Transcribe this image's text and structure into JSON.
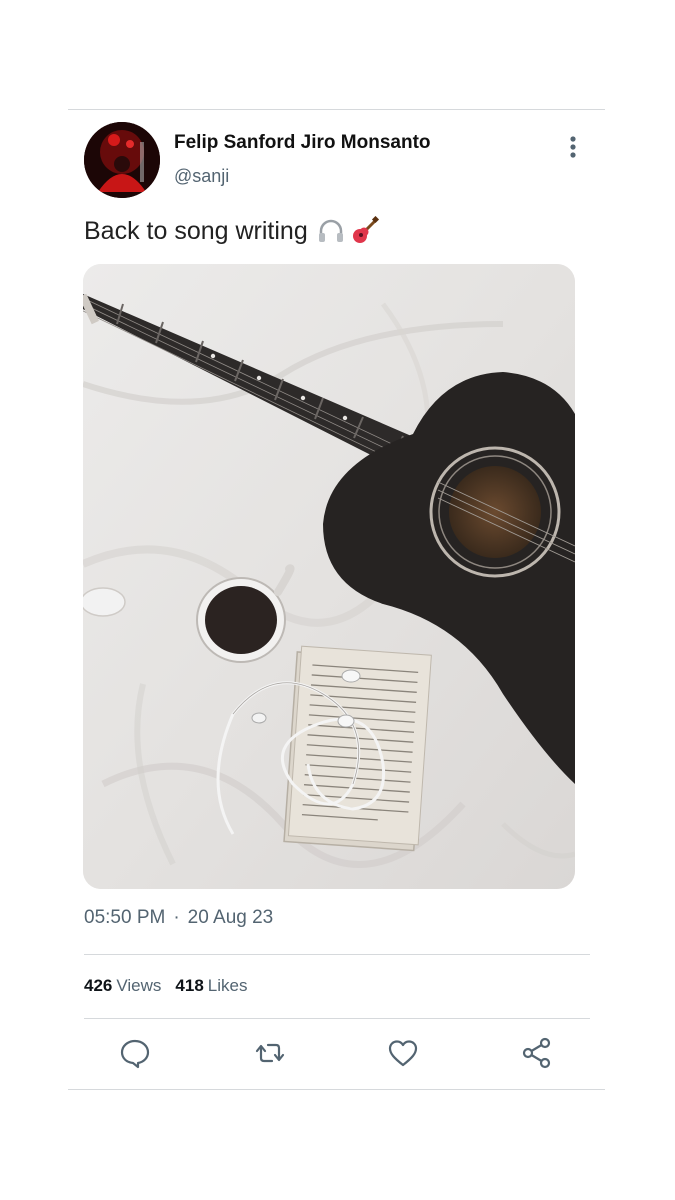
{
  "tweet": {
    "author_name": "Felip Sanford Jiro Monsanto",
    "handle": "@sanji",
    "text": "Back to song writing",
    "emojis": [
      "headphone-icon",
      "guitar-icon"
    ],
    "time": "05:50 PM",
    "separator": "·",
    "date": "20 Aug 23"
  },
  "stats": {
    "views_count": "426",
    "views_label": "Views",
    "likes_count": "418",
    "likes_label": "Likes"
  },
  "actions": [
    "reply-icon",
    "retweet-icon",
    "like-icon",
    "share-icon"
  ],
  "colors": {
    "text": "#0f1419",
    "secondary": "#536471",
    "divider": "#d6d9dc"
  }
}
